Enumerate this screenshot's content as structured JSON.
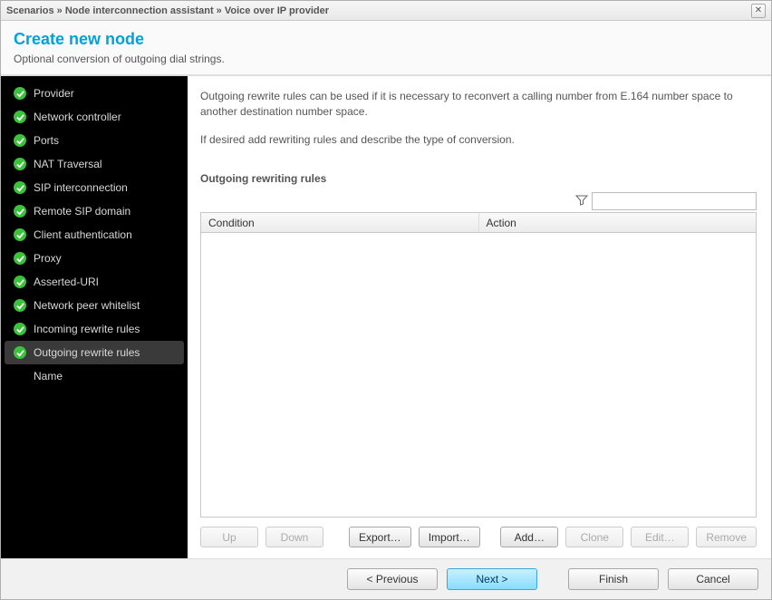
{
  "breadcrumb": "Scenarios » Node interconnection assistant » Voice over IP provider",
  "header": {
    "title": "Create new node",
    "subtitle": "Optional conversion of outgoing dial strings."
  },
  "sidebar": {
    "items": [
      {
        "label": "Provider",
        "done": true
      },
      {
        "label": "Network controller",
        "done": true
      },
      {
        "label": "Ports",
        "done": true
      },
      {
        "label": "NAT Traversal",
        "done": true
      },
      {
        "label": "SIP interconnection",
        "done": true
      },
      {
        "label": "Remote SIP domain",
        "done": true
      },
      {
        "label": "Client authentication",
        "done": true
      },
      {
        "label": "Proxy",
        "done": true
      },
      {
        "label": "Asserted-URI",
        "done": true
      },
      {
        "label": "Network peer whitelist",
        "done": true
      },
      {
        "label": "Incoming rewrite rules",
        "done": true
      },
      {
        "label": "Outgoing rewrite rules",
        "done": true,
        "selected": true
      },
      {
        "label": "Name",
        "done": false
      }
    ]
  },
  "content": {
    "intro1": "Outgoing rewrite rules can be used if it is necessary to reconvert a calling number from E.164 number space to another destination number space.",
    "intro2": "If desired add rewriting rules and describe the type of conversion.",
    "section_label": "Outgoing rewriting rules",
    "filter_placeholder": "",
    "columns": {
      "condition": "Condition",
      "action": "Action"
    },
    "rows": []
  },
  "buttons": {
    "up": "Up",
    "down": "Down",
    "export": "Export…",
    "import": "Import…",
    "add": "Add…",
    "clone": "Clone",
    "edit": "Edit…",
    "remove": "Remove"
  },
  "footer": {
    "previous": "< Previous",
    "next": "Next >",
    "finish": "Finish",
    "cancel": "Cancel"
  }
}
